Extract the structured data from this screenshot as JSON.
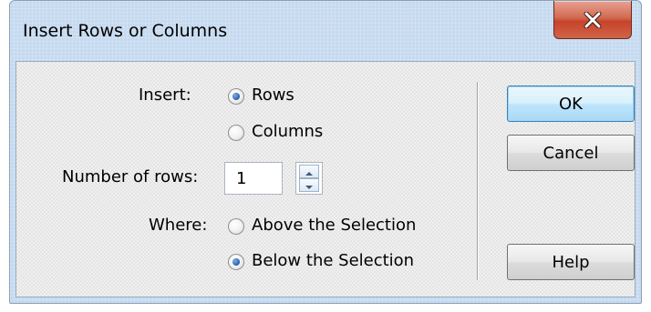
{
  "window": {
    "title": "Insert Rows or Columns",
    "close_icon": "close-icon"
  },
  "insert": {
    "label": "Insert:",
    "options": [
      {
        "label": "Rows",
        "selected": true
      },
      {
        "label": "Columns",
        "selected": false
      }
    ]
  },
  "count": {
    "label": "Number of rows:",
    "value": "1"
  },
  "where": {
    "label": "Where:",
    "options": [
      {
        "label": "Above the Selection",
        "selected": false
      },
      {
        "label": "Below the Selection",
        "selected": true
      }
    ]
  },
  "buttons": {
    "ok": "OK",
    "cancel": "Cancel",
    "help": "Help"
  },
  "colors": {
    "frame": "#c5d9ef",
    "close_button": "#c7432a",
    "default_button": "#3c7fb1"
  }
}
